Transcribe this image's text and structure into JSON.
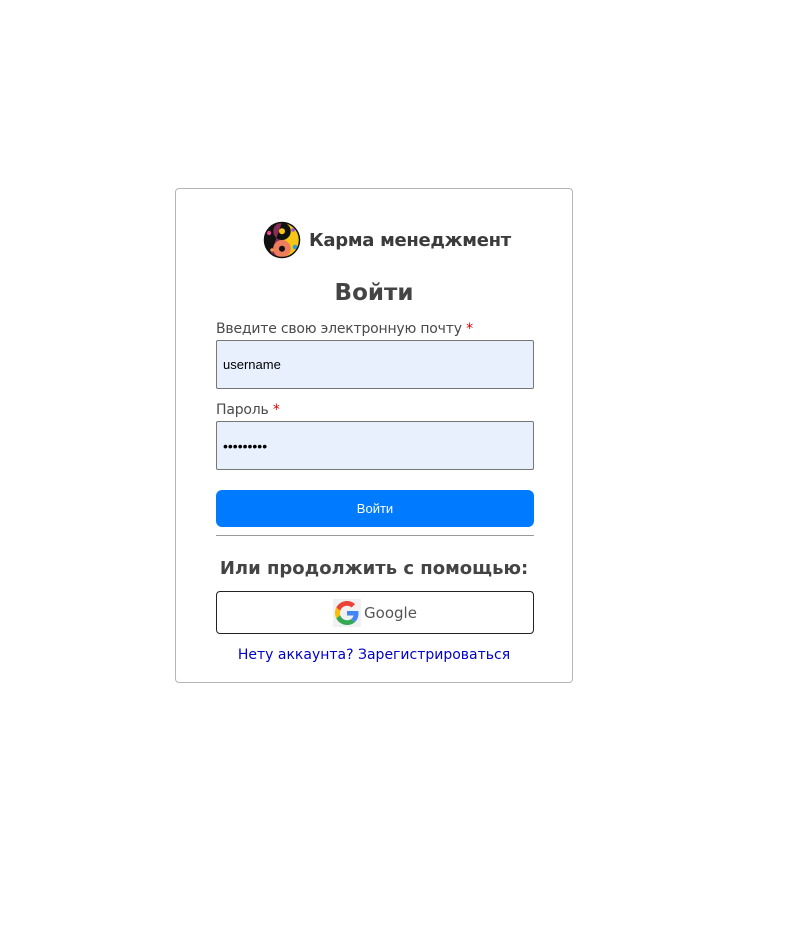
{
  "brand": {
    "name": "Карма менеджмент",
    "logo_icon": "yin-yang-logo-icon"
  },
  "login": {
    "title": "Войти",
    "email_label": "Введите свою электронную почту",
    "email_required_mark": "*",
    "email_value": "username",
    "password_label": "Пароль",
    "password_required_mark": "*",
    "password_value": "•••••••••",
    "submit_label": "Войти"
  },
  "alternatives": {
    "heading": "Или продолжить с помощью:",
    "google_label": "Google",
    "google_icon": "google-g-icon"
  },
  "register": {
    "link_text": "Нету аккаунта? Зарегистрироваться"
  },
  "colors": {
    "primary": "#007bff",
    "input_bg": "#e8f0fe",
    "link": "#0000cc",
    "required": "#d40000"
  }
}
